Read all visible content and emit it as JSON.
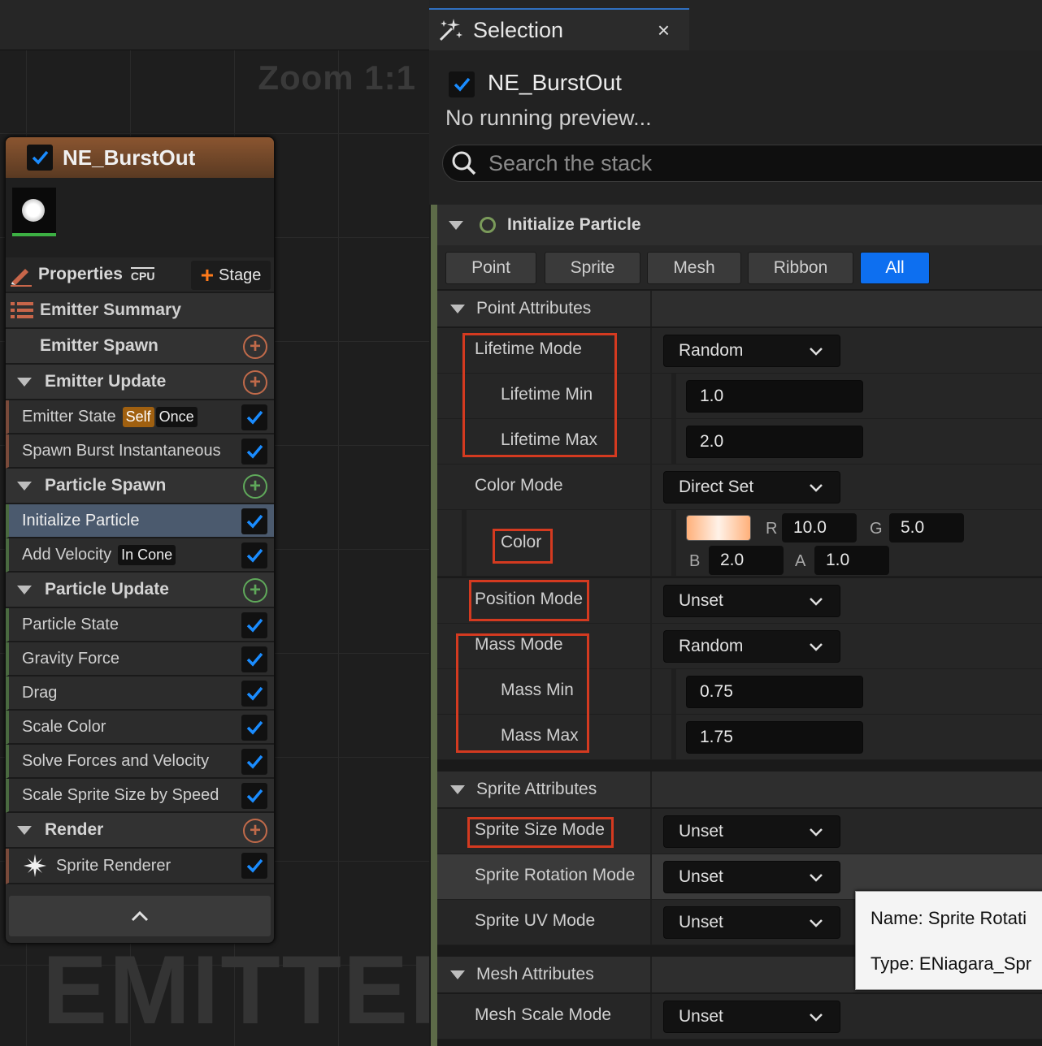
{
  "graph": {
    "zoom_label": "Zoom 1:1",
    "watermark": "EMITTER"
  },
  "node": {
    "title": "NE_BurstOut",
    "properties_label": "Properties",
    "cpu_label": "CPU",
    "stage_label": "Stage",
    "summary_label": "Emitter Summary",
    "sections": {
      "emitter_spawn": "Emitter Spawn",
      "emitter_update": "Emitter Update",
      "particle_spawn": "Particle Spawn",
      "particle_update": "Particle Update",
      "render": "Render"
    },
    "modules": {
      "emitter_state": "Emitter State",
      "emitter_state_tag1": "Self",
      "emitter_state_tag2": "Once",
      "spawn_burst": "Spawn Burst Instantaneous",
      "initialize_particle": "Initialize Particle",
      "add_velocity": "Add Velocity",
      "add_velocity_tag": "In Cone",
      "particle_state": "Particle State",
      "gravity_force": "Gravity Force",
      "drag": "Drag",
      "scale_color": "Scale Color",
      "solve_forces": "Solve Forces and Velocity",
      "scale_sprite": "Scale Sprite Size by Speed",
      "sprite_renderer": "Sprite Renderer"
    },
    "colors": {
      "header": "#8a5530",
      "selected": "#4b5a6e",
      "check": "#1a8cff"
    }
  },
  "panel": {
    "tab_label": "Selection",
    "tab_close": "×",
    "emitter_name": "NE_BurstOut",
    "preview_note": "No running preview...",
    "search_placeholder": "Search the stack",
    "module_header": "Initialize Particle",
    "filters": [
      "Point",
      "Sprite",
      "Mesh",
      "Ribbon",
      "All"
    ],
    "active_filter": "All",
    "point_attributes": {
      "label": "Point Attributes",
      "lifetime_mode": {
        "label": "Lifetime Mode",
        "value": "Random"
      },
      "lifetime_min": {
        "label": "Lifetime Min",
        "value": "1.0"
      },
      "lifetime_max": {
        "label": "Lifetime Max",
        "value": "2.0"
      },
      "color_mode": {
        "label": "Color Mode",
        "value": "Direct Set"
      },
      "color": {
        "label": "Color",
        "r_label": "R",
        "r": "10.0",
        "g_label": "G",
        "g": "5.0",
        "b_label": "B",
        "b": "2.0",
        "a_label": "A",
        "a": "1.0"
      },
      "position_mode": {
        "label": "Position Mode",
        "value": "Unset"
      },
      "mass_mode": {
        "label": "Mass Mode",
        "value": "Random"
      },
      "mass_min": {
        "label": "Mass Min",
        "value": "0.75"
      },
      "mass_max": {
        "label": "Mass Max",
        "value": "1.75"
      }
    },
    "sprite_attributes": {
      "label": "Sprite Attributes",
      "size_mode": {
        "label": "Sprite Size Mode",
        "value": "Unset"
      },
      "rotation_mode": {
        "label": "Sprite Rotation Mode",
        "value": "Unset"
      },
      "uv_mode": {
        "label": "Sprite UV Mode",
        "value": "Unset"
      }
    },
    "mesh_attributes": {
      "label": "Mesh Attributes",
      "scale_mode": {
        "label": "Mesh Scale Mode",
        "value": "Unset"
      }
    },
    "tooltip": {
      "name_line": "Name: Sprite Rotati",
      "type_line": "Type: ENiagara_Spr"
    }
  }
}
